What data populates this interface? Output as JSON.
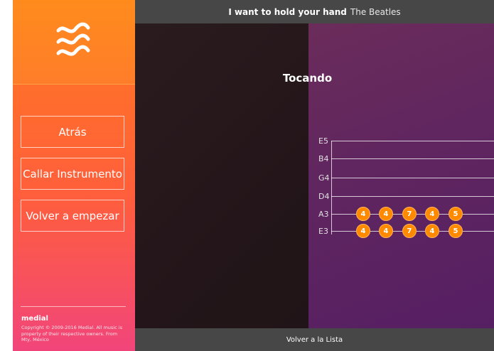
{
  "header": {
    "song": "I want to hold your hand",
    "artist": "The Beatles"
  },
  "status": "Tocando",
  "sidebar": {
    "logo_icon": "waves-icon",
    "buttons": [
      "Atrás",
      "Callar Instrumento",
      "Volver a empezar"
    ],
    "brand": "medial",
    "copyright": "Copyright © 2009-2016 Medial. All music is property of their respective owners. From Mty, México"
  },
  "tab": {
    "strings": [
      "E5",
      "B4",
      "G4",
      "D4",
      "A3",
      "E3"
    ],
    "notes": {
      "A3": [
        "4",
        "4",
        "7",
        "4",
        "5"
      ],
      "E3": [
        "4",
        "4",
        "7",
        "4",
        "5"
      ]
    },
    "note_color": "#ff8a00"
  },
  "footer": {
    "back_label": "Volver a la Lista"
  }
}
